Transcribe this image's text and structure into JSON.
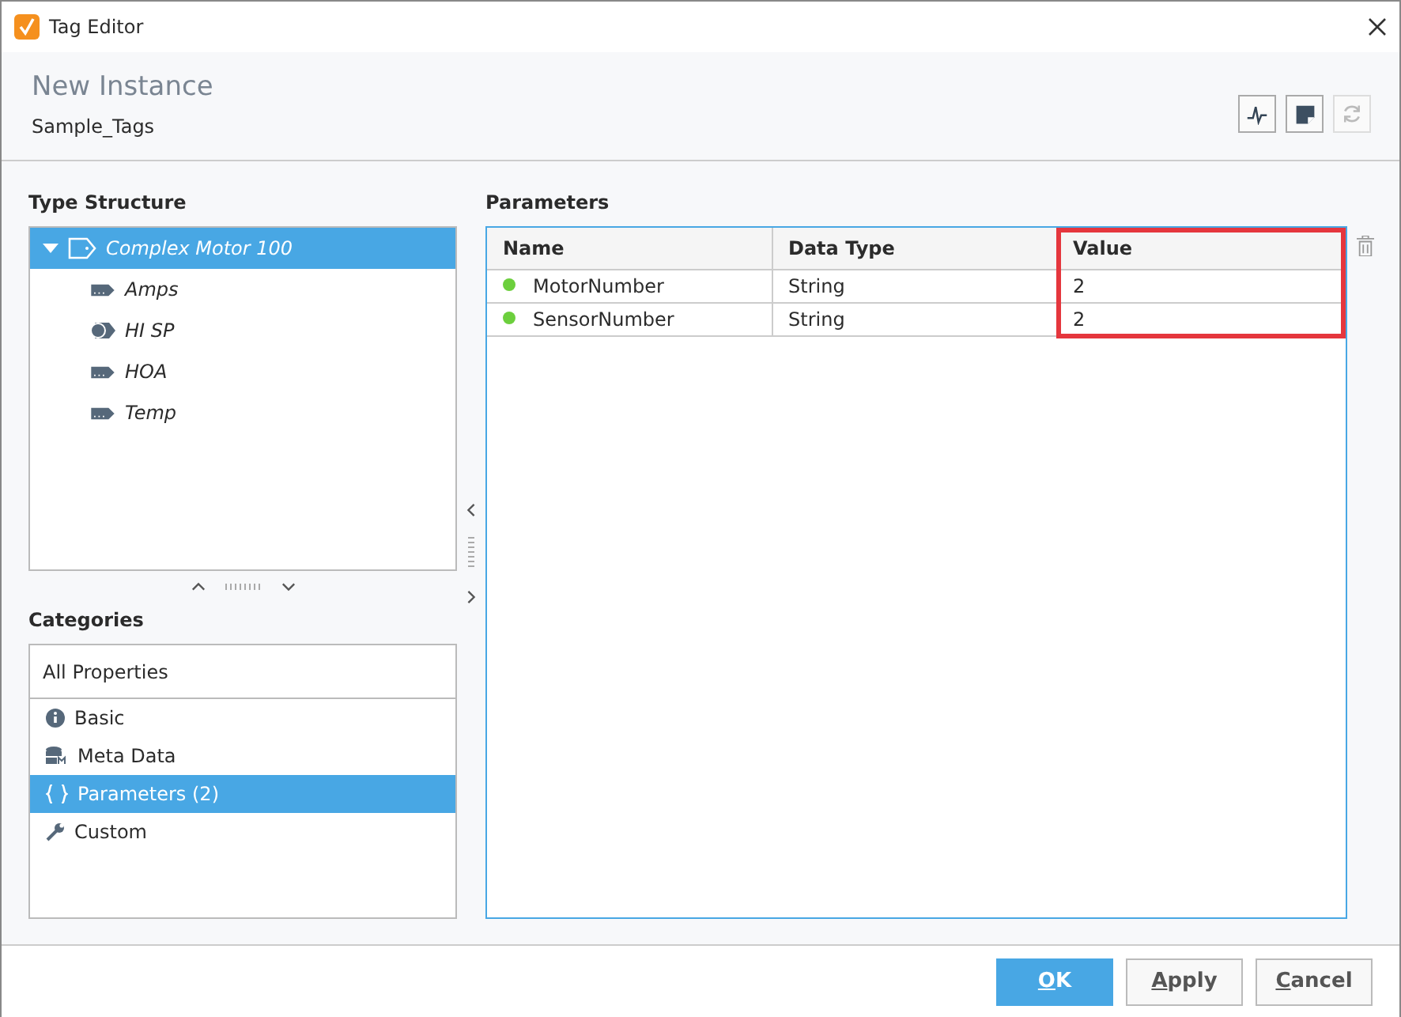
{
  "window": {
    "title": "Tag Editor"
  },
  "header": {
    "title": "New Instance",
    "subtitle": "Sample_Tags"
  },
  "type_structure": {
    "label": "Type Structure",
    "root": {
      "label": "Complex Motor 100",
      "expanded": true,
      "selected": true,
      "children": [
        {
          "label": "Amps",
          "kind": "tag",
          "selected": false
        },
        {
          "label": "HI SP",
          "kind": "expression",
          "selected": false
        },
        {
          "label": "HOA",
          "kind": "tag",
          "selected": false
        },
        {
          "label": "Temp",
          "kind": "tag",
          "selected": false
        }
      ]
    }
  },
  "categories": {
    "label": "Categories",
    "header": "All Properties",
    "items": [
      {
        "label": "Basic",
        "kind": "info",
        "selected": false
      },
      {
        "label": "Meta Data",
        "kind": "metadata",
        "selected": false
      },
      {
        "label": "Parameters (2)",
        "kind": "braces",
        "selected": true
      },
      {
        "label": "Custom",
        "kind": "wrench",
        "selected": false
      }
    ]
  },
  "parameters": {
    "label": "Parameters",
    "columns": [
      "Name",
      "Data Type",
      "Value"
    ],
    "rows": [
      {
        "name": "MotorNumber",
        "data_type": "String",
        "value": "2",
        "color": "#6ccf3d"
      },
      {
        "name": "SensorNumber",
        "data_type": "String",
        "value": "2",
        "color": "#6ccf3d"
      }
    ]
  },
  "buttons": [
    {
      "label": "OK",
      "kind": "primary"
    },
    {
      "label": "Apply",
      "kind": "secondary"
    },
    {
      "label": "Cancel",
      "kind": "secondary"
    }
  ]
}
